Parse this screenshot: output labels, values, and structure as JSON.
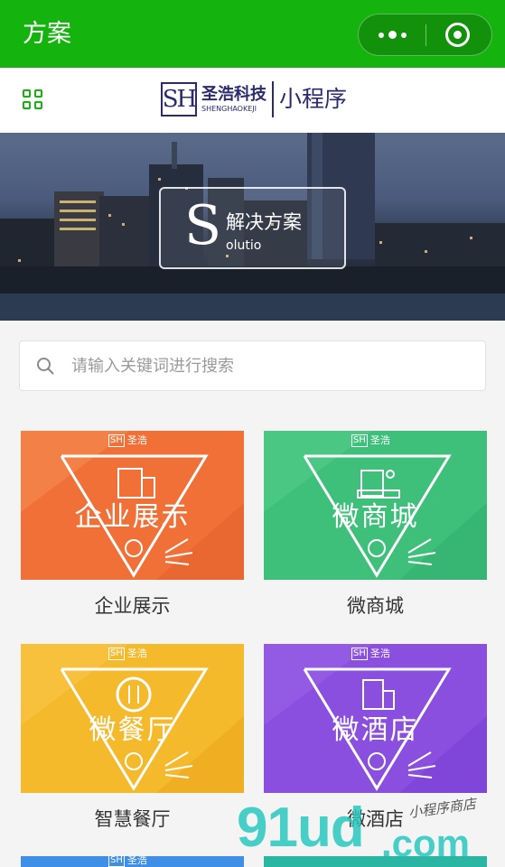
{
  "topbar": {
    "title": "方案"
  },
  "header": {
    "logo_mark": "SH",
    "logo_cn": "圣浩科技",
    "logo_en": "SHENGHAOKEJI",
    "logo_sub": "小程序"
  },
  "banner": {
    "letter": "S",
    "title": "解决方案",
    "subtitle": "olutio"
  },
  "search": {
    "placeholder": "请输入关键词进行搜索"
  },
  "cards": [
    {
      "label": "企业展示",
      "title": "企业展示",
      "brand": "圣浩",
      "color": "#f07038"
    },
    {
      "label": "微商城",
      "title": "微商城",
      "brand": "圣浩",
      "color": "#3ec07a"
    },
    {
      "label": "智慧餐厅",
      "title": "微餐厅",
      "brand": "圣浩",
      "color": "#f5b92c"
    },
    {
      "label": "微酒店",
      "title": "微酒店",
      "brand": "圣浩",
      "color": "#8b4fe0"
    }
  ],
  "bottom_cards": [
    {
      "brand": "圣浩",
      "color": "#3f8fe6"
    },
    {
      "color": "#2bb6a3"
    }
  ],
  "watermark": {
    "main": "91ud",
    "domain": ".com",
    "tag": "小程序商店"
  }
}
